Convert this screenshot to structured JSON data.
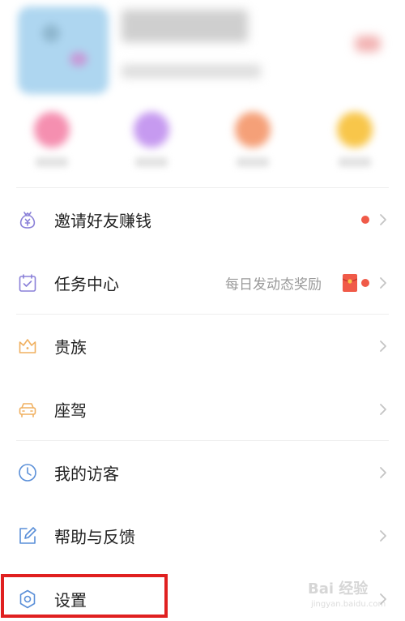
{
  "menu": {
    "items": [
      {
        "key": "invite",
        "label": "邀请好友赚钱",
        "icon": "money-bag-icon",
        "has_red_dot": true
      },
      {
        "key": "tasks",
        "label": "任务中心",
        "icon": "calendar-check-icon",
        "hint": "每日发动态奖励",
        "has_red_envelope": true,
        "has_red_dot": true
      },
      {
        "key": "nobility",
        "label": "贵族",
        "icon": "crown-icon"
      },
      {
        "key": "mount",
        "label": "座驾",
        "icon": "car-icon"
      },
      {
        "key": "visitors",
        "label": "我的访客",
        "icon": "clock-icon"
      },
      {
        "key": "help",
        "label": "帮助与反馈",
        "icon": "edit-icon"
      },
      {
        "key": "settings",
        "label": "设置",
        "icon": "gear-icon"
      }
    ]
  },
  "highlight": {
    "target": "settings",
    "color": "#e02020"
  },
  "watermark": {
    "line1": "Bai 经验",
    "line2": "jingyan.baidu.com"
  },
  "colors": {
    "red_dot": "#f05a48",
    "icon_blue": "#5a8fd8",
    "icon_purple": "#8a80d8",
    "icon_orange": "#f0b060",
    "hint_gray": "#9a9a9a",
    "chevron_gray": "#c4c4c4"
  }
}
